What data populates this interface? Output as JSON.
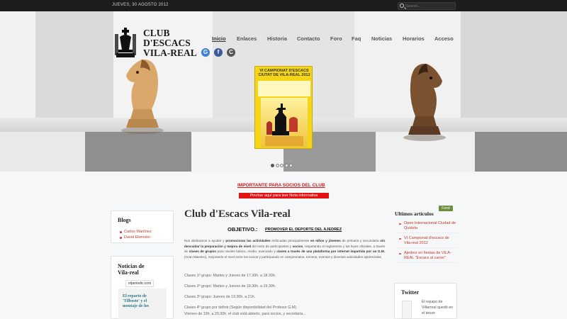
{
  "topbar": {
    "date": "JUEVES, 30 AGOSTO 2012",
    "search_placeholder": "Search..."
  },
  "site": {
    "logo_line1": "CLUB",
    "logo_line2": "D'ESCACS",
    "logo_line3": "VILA-REAL"
  },
  "nav": [
    "Inicio",
    "Enlaces",
    "Historia",
    "Contacto",
    "Foro",
    "Faq",
    "Noticias",
    "Horarios",
    "Acceso"
  ],
  "social": [
    {
      "icon": "google-icon",
      "color": "#3b7fd6",
      "glyph": "G"
    },
    {
      "icon": "facebook-icon",
      "color": "#3b5998",
      "glyph": "f"
    },
    {
      "icon": "rss-icon",
      "color": "#555555",
      "glyph": "C"
    }
  ],
  "poster": {
    "title_line1": "VI CAMPIONAT D'ESCACS",
    "title_line2": "CIUTAT DE VILA-REAL 2012"
  },
  "slider": {
    "total": 5,
    "active": 1
  },
  "notices": {
    "important": "IMPORTANTE PARA SOCIOS DEL CLUB",
    "link": "Pinchar aquí para leer Nota informativa"
  },
  "blogs": {
    "title": "Blogs",
    "items": [
      "Carlos Martínez",
      "David Ebensler"
    ]
  },
  "noticias": {
    "title_line1": "Noticias de",
    "title_line2": "Vila-real",
    "source": "elperiodic.com",
    "headline_line1": "El reparto de",
    "headline_line2": "'Tilboste' y el",
    "headline_line3": "montaje de los"
  },
  "main": {
    "title": "Club d'Escacs Vila-real",
    "objetivo_label": "OBJETIVO.:",
    "objetivo_text": "PROMOVER EL DEPORTE DEL AJEDREZ",
    "paragraph_start": "Nos dedicamos a ayudar y ",
    "paragraph_b1": "promocionar las actividades",
    "paragraph_mid1": " enfocadas principalmente ",
    "paragraph_b2": "en niños y jóvenes",
    "paragraph_mid2": " de primaria y secundaria ",
    "paragraph_b3": "sin descuidar la preparación y mejora de nivel",
    "paragraph_mid3": " del resto de participantes y ",
    "paragraph_b4": "socios",
    "paragraph_mid4": ", respetando el reglamento y las leyes oficiales, a través de ",
    "paragraph_b5": "clases de grupos",
    "paragraph_mid5": " para niveles básico, medio, avanzado y ",
    "paragraph_b6": "clases a través de una plataforma por internet impartida por un G.M.",
    "paragraph_end": " (Gran Maestro), mejorando el nivel entre los socios y participando en campeonatos, torneos, eventos y diversas actividades ajedrecistas.",
    "groups": [
      "Clases 1º grupo: Martes y Jueves de 17.30h. a 18.30h.",
      "Clases 2º grupo: Martes y Jueves de 18.30h. a 19.30h.",
      "Clases 3º grupo: Jueves de 19.30h. a 21h.",
      "Clases 4º grupo por definir (Según disponibilidad del Profesor G.M)",
      "Viernes de 19h. a 20.30h. el club está abierto, para socios, y secretaría..."
    ]
  },
  "right": {
    "title": "Ultimos artículos",
    "feed_label": "Feed",
    "items": [
      "Open Internacional Ciudad de Quidela",
      "VI Campionat d'escacs de Vila-real 2012",
      "Ajedrez en fiestas de VILA-REAL \"Escacs al carrer\""
    ],
    "twitter_title": "Twitter",
    "twitter_text": "El equipo de Villarreal quedó en el tercer"
  }
}
